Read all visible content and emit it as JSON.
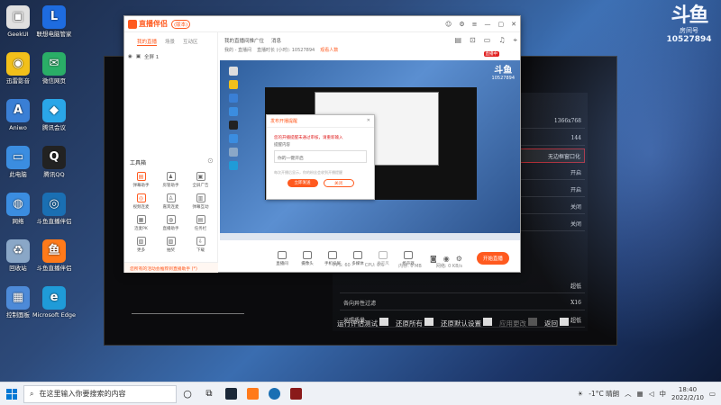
{
  "desktop": {
    "icons": [
      {
        "label": "GeekUI",
        "color": "#e0e0e0",
        "glyph": "▣"
      },
      {
        "label": "联想电脑管家",
        "color": "#1e6ce0",
        "glyph": "L"
      },
      {
        "label": "迅雷影音",
        "color": "#f2c01a",
        "glyph": "◉"
      },
      {
        "label": "微信网页",
        "color": "#2aae67",
        "glyph": "✉"
      },
      {
        "label": "Aniwo",
        "color": "#3a7fd5",
        "glyph": "A"
      },
      {
        "label": "腾讯会议",
        "color": "#2aa6e8",
        "glyph": "◆"
      },
      {
        "label": "此电脑",
        "color": "#3b8de0",
        "glyph": "▭"
      },
      {
        "label": "腾讯QQ",
        "color": "#222222",
        "glyph": "Q"
      },
      {
        "label": "网络",
        "color": "#3b8de0",
        "glyph": "◍"
      },
      {
        "label": "斗鱼直播伴侣",
        "color": "#1a6fb3",
        "glyph": "◎"
      },
      {
        "label": "回收站",
        "color": "#8aa7c7",
        "glyph": "♻"
      },
      {
        "label": "斗鱼直播伴侣",
        "color": "#ff7a1a",
        "glyph": "鱼"
      },
      {
        "label": "控制面板",
        "color": "#4d8ad8",
        "glyph": "▦"
      },
      {
        "label": "Microsoft Edge",
        "color": "#1f9bd8",
        "glyph": "e"
      }
    ]
  },
  "douyu": {
    "mark": "斗鱼",
    "room_label": "房间号",
    "room_number": "10527894"
  },
  "game": {
    "rows": [
      {
        "label": "",
        "value": "1366x768"
      },
      {
        "label": "",
        "value": "144"
      },
      {
        "label": "",
        "value": "无边框窗口化"
      },
      {
        "label": "",
        "value": "开启"
      },
      {
        "label": "",
        "value": "开启"
      },
      {
        "label": "",
        "value": "关闭"
      },
      {
        "label": "",
        "value": "关闭"
      },
      {
        "label": "",
        "value": "超低"
      },
      {
        "label": "各向异性过滤",
        "value": "X16"
      },
      {
        "label": "光照质量",
        "value": "超低"
      }
    ],
    "footer": {
      "run": "运行评估测试",
      "run_key": "",
      "reset_all": "还原所有",
      "reset_key": "",
      "reset_default": "还原默认设置",
      "reset_default_key": "",
      "apply": "应用更改",
      "back": "返回"
    }
  },
  "app": {
    "title": "直播伴侣",
    "version": "(版本)",
    "left_tabs": [
      "我的直播",
      "场景",
      "互动区"
    ],
    "scene": "全屏 1",
    "toolbox_title": "工具箱",
    "tools": [
      {
        "label": "弹幕助手",
        "glyph": "▤",
        "red": true
      },
      {
        "label": "房管助手",
        "glyph": "♟",
        "red": false
      },
      {
        "label": "全屏广告",
        "glyph": "▣",
        "red": false
      },
      {
        "label": "视频连麦",
        "glyph": "◎",
        "red": true
      },
      {
        "label": "嘉宾连麦",
        "glyph": "♙",
        "red": false
      },
      {
        "label": "弹幕互动",
        "glyph": "▥",
        "red": false
      },
      {
        "label": "连麦PK",
        "glyph": "▦",
        "red": false
      },
      {
        "label": "直播助手",
        "glyph": "◍",
        "red": false
      },
      {
        "label": "任务栏",
        "glyph": "▤",
        "red": false
      },
      {
        "label": "更多",
        "glyph": "▧",
        "red": false
      },
      {
        "label": "抽奖",
        "glyph": "▨",
        "red": false
      },
      {
        "label": "下载",
        "glyph": "⇩",
        "red": false
      }
    ],
    "footer_notice": "您所有的活动会推荐到直播助手 (*)",
    "right_tabs": [
      "我的直播间推广位",
      "消息"
    ],
    "right_sub": [
      "我的 - 直播间",
      "直播时长 (小时): 10527894",
      "观看人数"
    ],
    "live_badge": "直播中",
    "dialog": {
      "title": "发布开播提醒",
      "warning": "您的开播提醒未通过审核，请重新输入",
      "field_label": "提醒内容",
      "value": "你的一键开启",
      "hint": "每次开播后显示，你的粉丝会收到开播提醒",
      "ok": "立即发送",
      "cancel": "关闭"
    },
    "bottom_buttons": [
      {
        "label": "直播间",
        "dim": false
      },
      {
        "label": "摄像头",
        "dim": false
      },
      {
        "label": "手机投屏",
        "dim": false
      },
      {
        "label": "多媒体",
        "dim": false
      },
      {
        "label": "麦克风",
        "dim": true
      },
      {
        "label": "扬声器",
        "dim": false
      }
    ],
    "start_live": "开始直播",
    "status": [
      "FPS: 60",
      "CPU: 0%",
      "内存: 0 MB",
      "网络: 0 KB/s"
    ]
  },
  "taskbar": {
    "search_placeholder": "在这里输入你要搜索的内容",
    "weather": "-1°C 晴朗",
    "ime": "中",
    "time": "18:40",
    "date": "2022/2/10"
  }
}
